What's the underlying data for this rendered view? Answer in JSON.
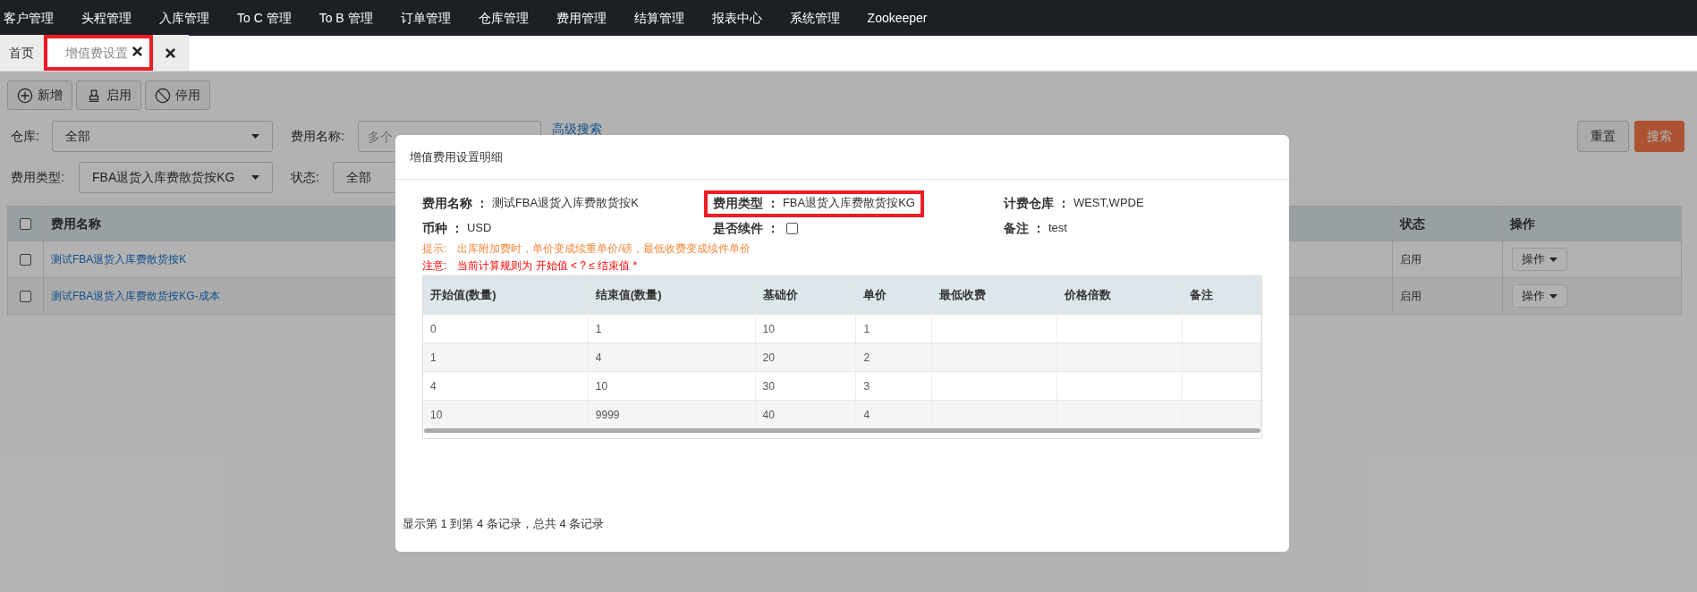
{
  "nav": {
    "items": [
      "客户管理",
      "头程管理",
      "入库管理",
      "To C 管理",
      "To B 管理",
      "订单管理",
      "仓库管理",
      "费用管理",
      "结算管理",
      "报表中心",
      "系统管理",
      "Zookeeper"
    ]
  },
  "tabs": [
    {
      "kind": "text",
      "label": "首页",
      "selected": false,
      "closable": false,
      "highlighted": false
    },
    {
      "kind": "text",
      "label": "增值费设置",
      "selected": true,
      "closable": true,
      "highlighted": true
    },
    {
      "kind": "icon",
      "selected": false,
      "closable": true,
      "highlighted": false
    }
  ],
  "toolbar": [
    {
      "kind": "add",
      "label": "新增"
    },
    {
      "kind": "enable",
      "label": "启用"
    },
    {
      "kind": "disable",
      "label": "停用"
    }
  ],
  "filters": {
    "warehouse": {
      "label": "仓库:",
      "value": "全部"
    },
    "fee_name": {
      "label": "费用名称:",
      "placeholder": "多个"
    },
    "advanced_search": "高级搜索",
    "fee_type": {
      "label": "费用类型:",
      "value": "FBA退货入库费散货按KG"
    },
    "status": {
      "label": "状态:",
      "value": "全部"
    },
    "reset": "重置",
    "search": "搜索"
  },
  "table": {
    "header_checked": false,
    "columns": [
      "费用名称",
      "状态",
      "操作"
    ],
    "rows": [
      {
        "checked": false,
        "name": "测试FBA退货入库费散货按K",
        "status": "启用",
        "action": "操作"
      },
      {
        "checked": false,
        "name": "测试FBA退货入库费散货按KG-成本",
        "status": "启用",
        "action": "操作"
      }
    ]
  },
  "modal": {
    "title": "增值费用设置明细",
    "fields": [
      {
        "kind": "text",
        "label": "费用名称 ：",
        "value": "测试FBA退货入库费散货按K",
        "highlighted": false
      },
      {
        "kind": "text",
        "label": "费用类型 ：",
        "value": "FBA退货入库费散货按KG",
        "highlighted": true
      },
      {
        "kind": "text",
        "label": "计费仓库 ：",
        "value": "WEST,WPDE",
        "highlighted": false
      },
      {
        "kind": "text",
        "label": "币种 ：",
        "value": "USD",
        "highlighted": false
      },
      {
        "kind": "checkbox",
        "label": "是否续件 ：",
        "checked": false,
        "highlighted": false
      },
      {
        "kind": "text",
        "label": "备注 ：",
        "value": "test",
        "highlighted": false
      }
    ],
    "hint": {
      "label": "提示:",
      "text": "出库附加费时，单价变成续重单价/磅，最低收费变成续件单价"
    },
    "note": {
      "label": "注意:",
      "text": "当前计算规则为 开始值 < ? ≤ 结束值 *"
    },
    "detail_table": {
      "columns": [
        "开始值(数量)",
        "结束值(数量)",
        "基础价",
        "单价",
        "最低收费",
        "价格倍数",
        "备注"
      ],
      "rows": [
        {
          "cells": [
            "0",
            "1",
            "10",
            "1"
          ]
        },
        {
          "cells": [
            "1",
            "4",
            "20",
            "2"
          ]
        },
        {
          "cells": [
            "4",
            "10",
            "30",
            "3"
          ]
        },
        {
          "cells": [
            "10",
            "9999",
            "40",
            "4"
          ]
        }
      ]
    },
    "footer": "显示第 1 到第 4 条记录，总共 4 条记录"
  }
}
